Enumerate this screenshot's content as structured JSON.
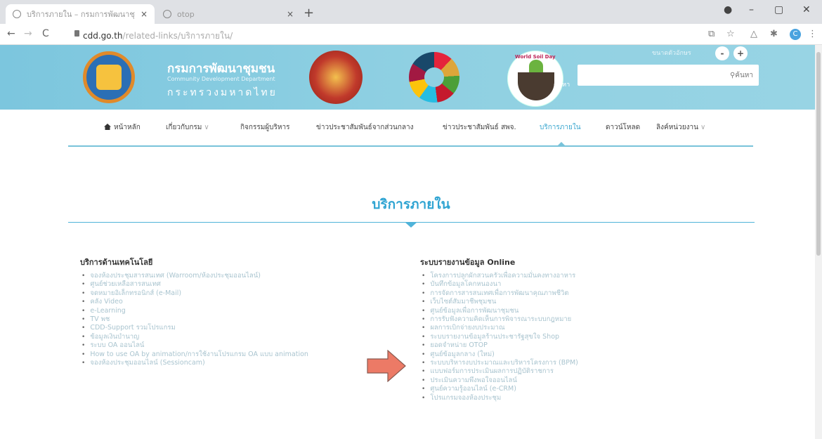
{
  "browser": {
    "tabs": [
      {
        "title": "บริการภายใน – กรมการพัฒนาชุมชน",
        "close": "×"
      },
      {
        "title": "otop",
        "close": "×"
      }
    ],
    "new_tab": "+",
    "window": {
      "minimize": "–",
      "restore": "▢",
      "close": "✕"
    },
    "nav": {
      "back": "←",
      "forward": "→",
      "reload": "C"
    },
    "url_host": "cdd.go.th",
    "url_path": "/related-links/บริการภายใน/",
    "menu": "⋮",
    "profile_initial": "C"
  },
  "header": {
    "title": "กรมการพัฒนาชุมชน",
    "subtitle_en": "Community Development Department",
    "subtitle_ministry": "กระทรวงมหาดไทย",
    "wsd_label": "World Soil Day",
    "search_label": "ค้นหา",
    "search_button": "ค้นหา",
    "font_size_label": "ขนาดตัวอักษร",
    "font_minus": "-",
    "font_plus": "+"
  },
  "nav": {
    "items": [
      {
        "label": "หน้าหลัก"
      },
      {
        "label": "เกี่ยวกับกรม",
        "chevron": "∨"
      },
      {
        "label": "กิจกรรมผู้บริหาร"
      },
      {
        "label": "ข่าวประชาสัมพันธ์จากส่วนกลาง"
      },
      {
        "label": "ข่าวประชาสัมพันธ์ สพจ."
      },
      {
        "label": "บริการภายใน"
      },
      {
        "label": "ดาวน์โหลด"
      },
      {
        "label": "ลิงค์หน่วยงาน",
        "chevron": "∨"
      }
    ],
    "active_index": 5
  },
  "page": {
    "title": "บริการภายใน",
    "left_column": {
      "heading": "บริการด้านเทคโนโลยี",
      "links": [
        "จองห้องประชุมสารสนเทศ (Warroom/ห้องประชุมออนไลน์)",
        "ศูนย์ช่วยเหลือสารสนเทศ",
        "จดหมายอิเล็กทรอนิกส์ (e-Mail)",
        "คลัง Video",
        "e-Learning",
        "TV พช",
        "CDD-Support รวมโปรแกรม",
        "ข้อมูลเงินบำนาญ",
        "ระบบ OA ออนไลน์",
        "How to use OA by animation/การใช้งานโปรแกรม OA แบบ animation",
        "จองห้องประชุมออนไลน์ (Sessioncam)"
      ]
    },
    "right_column": {
      "heading": "ระบบรายงานข้อมูล Online",
      "links": [
        "โครงการปลูกผักสวนครัวเพื่อความมั่นคงทางอาหาร",
        "บันทึกข้อมูลโคกหนองนา",
        "การจัดการสารสนเทศเพื่อการพัฒนาคุณภาพชีวิต",
        "เว็บไซต์สัมมาชีพชุมชน",
        "ศูนย์ข้อมูลเพื่อการพัฒนาชุมชน",
        "การรับฟังความคิดเห็นการพิจารณาระบบกฎหมาย",
        "ผลการเบิกจ่ายงบประมาณ",
        "ระบบรายงานข้อมูลร้านประชารัฐสุขใจ Shop",
        "ยอดจำหน่าย OTOP",
        "ศูนย์ข้อมูลกลาง (ใหม่)",
        "ระบบบริหารงบประมาณและบริหารโครงการ (BPM)",
        "แบบฟอร์มการประเมินผลการปฏิบัติราชการ",
        "ประเมินความพึงพอใจออนไลน์",
        "ศูนย์ความรู้ออนไลน์ (e-CRM)",
        "โปรแกรมจองห้องประชุม"
      ]
    }
  },
  "colors": {
    "banner": "#8fd0e2",
    "accent": "#2fa4d2",
    "arrow": "#ec7a66",
    "link_faded": "#a9c4cf"
  }
}
